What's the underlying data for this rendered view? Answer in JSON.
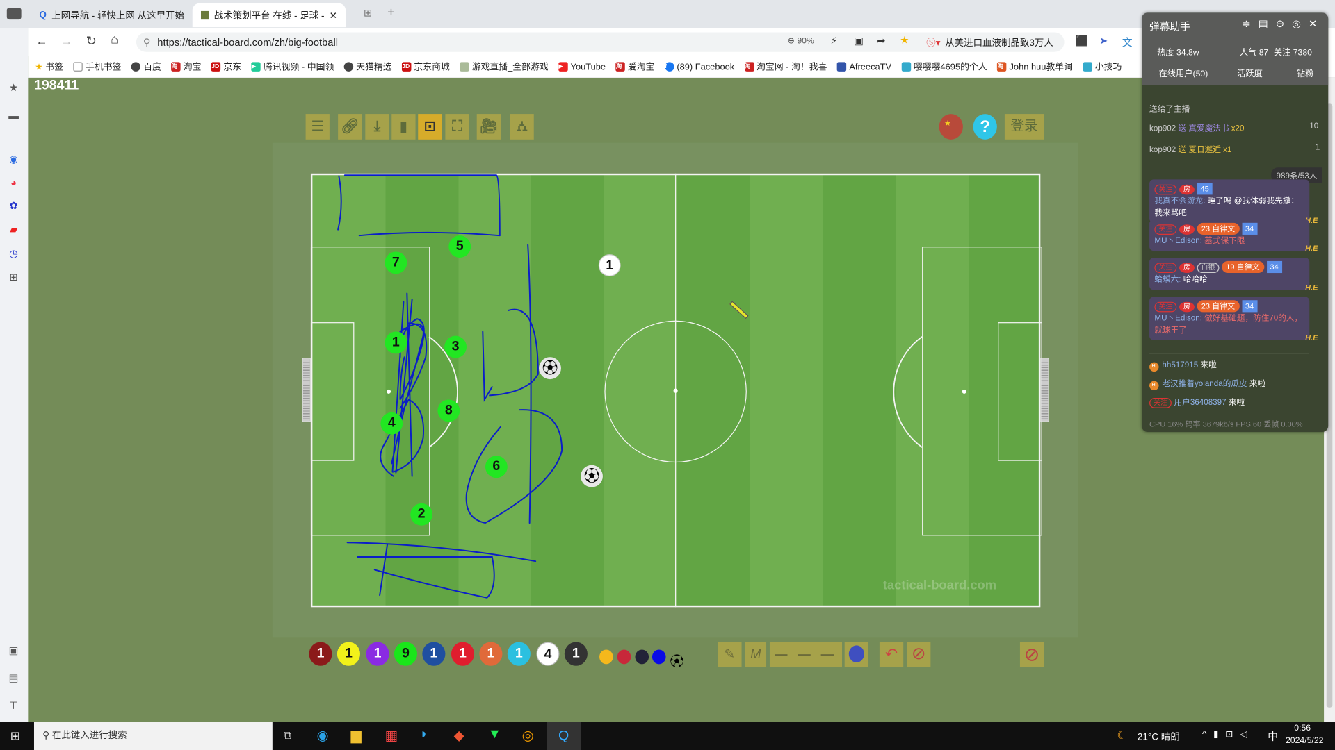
{
  "browser": {
    "tabs": [
      {
        "label": "上网导航 - 轻快上网 从这里开始"
      },
      {
        "label": "战术策划平台 在线 - 足球 - ta"
      }
    ],
    "url": "https://tactical-board.com/zh/big-football",
    "zoom": "90%",
    "news_ticker": "从美进口血液制品致3万人",
    "bookmarks": [
      "书签",
      "手机书签",
      "百度",
      "淘宝",
      "京东",
      "腾讯视频 - 中国领",
      "天猫精选",
      "京东商城",
      "游戏直播_全部游戏",
      "YouTube",
      "爱淘宝",
      "(89) Facebook",
      "淘宝网 - 淘！我喜",
      "AfreecaTV",
      "嘤嘤嘤4695的个人",
      "John huu教单词",
      "小技巧"
    ]
  },
  "page": {
    "counter": "198411",
    "login_label": "登录",
    "watermark": "tactical-board.com",
    "toolbar_icons": [
      "menu-icon",
      "link-icon",
      "download-icon",
      "bookmark-icon",
      "field-view-icon",
      "fullscreen-icon",
      "video-camera-icon",
      "formation-icon"
    ],
    "players_green": [
      "7",
      "5",
      "1",
      "3",
      "4",
      "8",
      "6",
      "2"
    ],
    "player_white": "1",
    "palette_discs": [
      {
        "label": "1",
        "color": "#8b1a1a"
      },
      {
        "label": "1",
        "color": "#f2f21a"
      },
      {
        "label": "1",
        "color": "#8a2be2"
      },
      {
        "label": "9",
        "color": "#1ae61a"
      },
      {
        "label": "1",
        "color": "#1f4fa0"
      },
      {
        "label": "1",
        "color": "#e01e2e"
      },
      {
        "label": "1",
        "color": "#e06a3a"
      },
      {
        "label": "1",
        "color": "#2bc0e0"
      },
      {
        "label": "4",
        "color": "#ffffff"
      },
      {
        "label": "1",
        "color": "#333333"
      }
    ],
    "palette_dots": [
      "#f5b81c",
      "#c8283a",
      "#222238",
      "#0a0ae6"
    ],
    "draw_color": "#0a1ec8"
  },
  "danmaku": {
    "title": "弹幕助手",
    "stats": {
      "heat": "热度 34.8w",
      "popularity": "人气 87",
      "follow": "关注 7380"
    },
    "tabs": [
      "在线用户(50)",
      "活跃度",
      "钻粉"
    ],
    "gift_lines": [
      {
        "text": "送给了主播"
      },
      {
        "user": "kop902",
        "gift": "送 真爱魔法书",
        "count": "x20",
        "value": "10"
      },
      {
        "user": "kop902",
        "gift": "送 夏日邂逅",
        "count": "x1",
        "value": "1"
      }
    ],
    "count_badge": "989条/53人",
    "messages": [
      {
        "tag": "关注",
        "room": "房",
        "fan": "45",
        "user": "我真不会游龙:",
        "text": "睡了吗 @我体弱我先撤：我来骂吧",
        "medal": "H.E"
      },
      {
        "tag": "关注",
        "room": "房",
        "level": "23",
        "title": "自律文",
        "fan": "34",
        "user": "MU丶Edison:",
        "text": "墓式保下限",
        "medal": "H.E"
      },
      {
        "tag": "关注",
        "room": "房",
        "badge": "白银",
        "level": "19",
        "title": "自律文",
        "fan": "34",
        "user": "蛤蟆六:",
        "text": "哈哈哈",
        "medal": "H.E"
      },
      {
        "tag": "关注",
        "room": "房",
        "level": "23",
        "title": "自律文",
        "fan": "34",
        "user": "MU丶Edison:",
        "text": "做好基础题，防住70的人，就球王了",
        "medal": "H.E"
      }
    ],
    "entries": [
      {
        "user": "hh517915",
        "action": "来啦"
      },
      {
        "user": "老汉推着yolanda的瓜皮",
        "action": "来啦"
      },
      {
        "tag": "关注",
        "user": "用户36408397",
        "action": "来啦"
      }
    ],
    "footer": "CPU 16% 码率 3679kb/s FPS 60 丢帧 0.00%"
  },
  "taskbar": {
    "search_placeholder": "在此键入进行搜索",
    "weather": "21°C 晴朗",
    "ime": "中",
    "time": "0:56",
    "date": "2024/5/22"
  }
}
